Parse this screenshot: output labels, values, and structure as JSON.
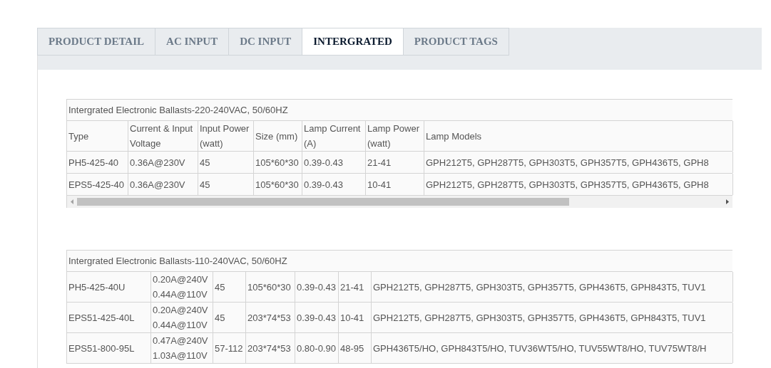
{
  "tabs": [
    {
      "label": "PRODUCT DETAIL",
      "selected": false
    },
    {
      "label": "AC INPUT",
      "selected": false
    },
    {
      "label": "DC INPUT",
      "selected": false
    },
    {
      "label": "INTERGRATED",
      "selected": true
    },
    {
      "label": "PRODUCT TAGS",
      "selected": false
    }
  ],
  "tables": [
    {
      "title": "Intergrated Electronic Ballasts-220-240VAC, 50/60HZ",
      "scrollbar": true,
      "columns": [
        "Type",
        "Current & Input Voltage",
        "Input Power (watt)",
        "Size (mm)",
        "Lamp Current (A)",
        "Lamp Power (watt)",
        "Lamp Models"
      ],
      "rows": [
        [
          "PH5-425-40",
          "0.36A@230V",
          "45",
          "105*60*30",
          "0.39-0.43",
          "21-41",
          "GPH212T5, GPH287T5, GPH303T5, GPH357T5, GPH436T5, GPH8"
        ],
        [
          "EPS5-425-40",
          "0.36A@230V",
          "45",
          "105*60*30",
          "0.39-0.43",
          "10-41",
          "GPH212T5, GPH287T5, GPH303T5, GPH357T5, GPH436T5, GPH8"
        ]
      ]
    },
    {
      "title": "Intergrated Electronic Ballasts-110-240VAC, 50/60HZ",
      "scrollbar": false,
      "rows": [
        [
          "PH5-425-40U",
          "0.20A@240V 0.44A@110V",
          "45",
          "105*60*30",
          "0.39-0.43",
          "21-41",
          "GPH212T5, GPH287T5, GPH303T5, GPH357T5, GPH436T5, GPH843T5, TUV1"
        ],
        [
          "EPS51-425-40L",
          "0.20A@240V 0.44A@110V",
          "45",
          "203*74*53",
          "0.39-0.43",
          "10-41",
          "GPH212T5, GPH287T5, GPH303T5, GPH357T5, GPH436T5, GPH843T5, TUV1"
        ],
        [
          "EPS51-800-95L",
          "0.47A@240V 1.03A@110V",
          "57-112",
          "203*74*53",
          "0.80-0.90",
          "48-95",
          "GPH436T5/HO, GPH843T5/HO, TUV36WT5/HO, TUV55WT8/HO, TUV75WT8/H"
        ]
      ]
    }
  ]
}
